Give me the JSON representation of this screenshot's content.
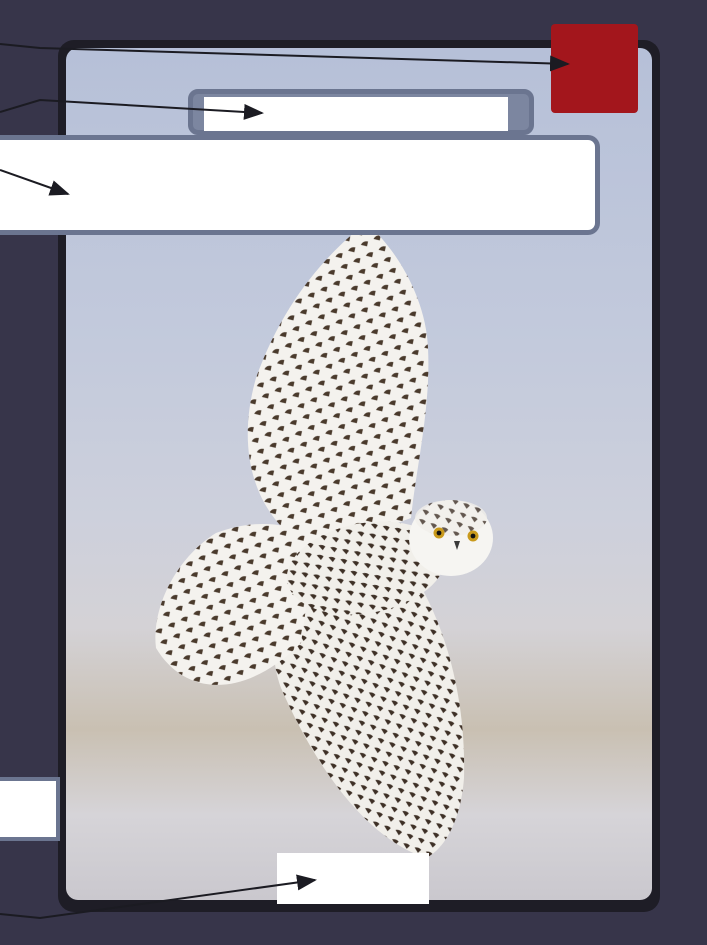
{
  "diagram": {
    "subject": "snowy-owl",
    "labels": {
      "corner_label": "",
      "name_label": "",
      "caption_label": "",
      "side_label": "",
      "bottom_label": ""
    },
    "colors": {
      "background": "#37354a",
      "corner_box": "#a3161c",
      "box_border": "#6b7590",
      "leader_line": "#1b1b22"
    }
  }
}
